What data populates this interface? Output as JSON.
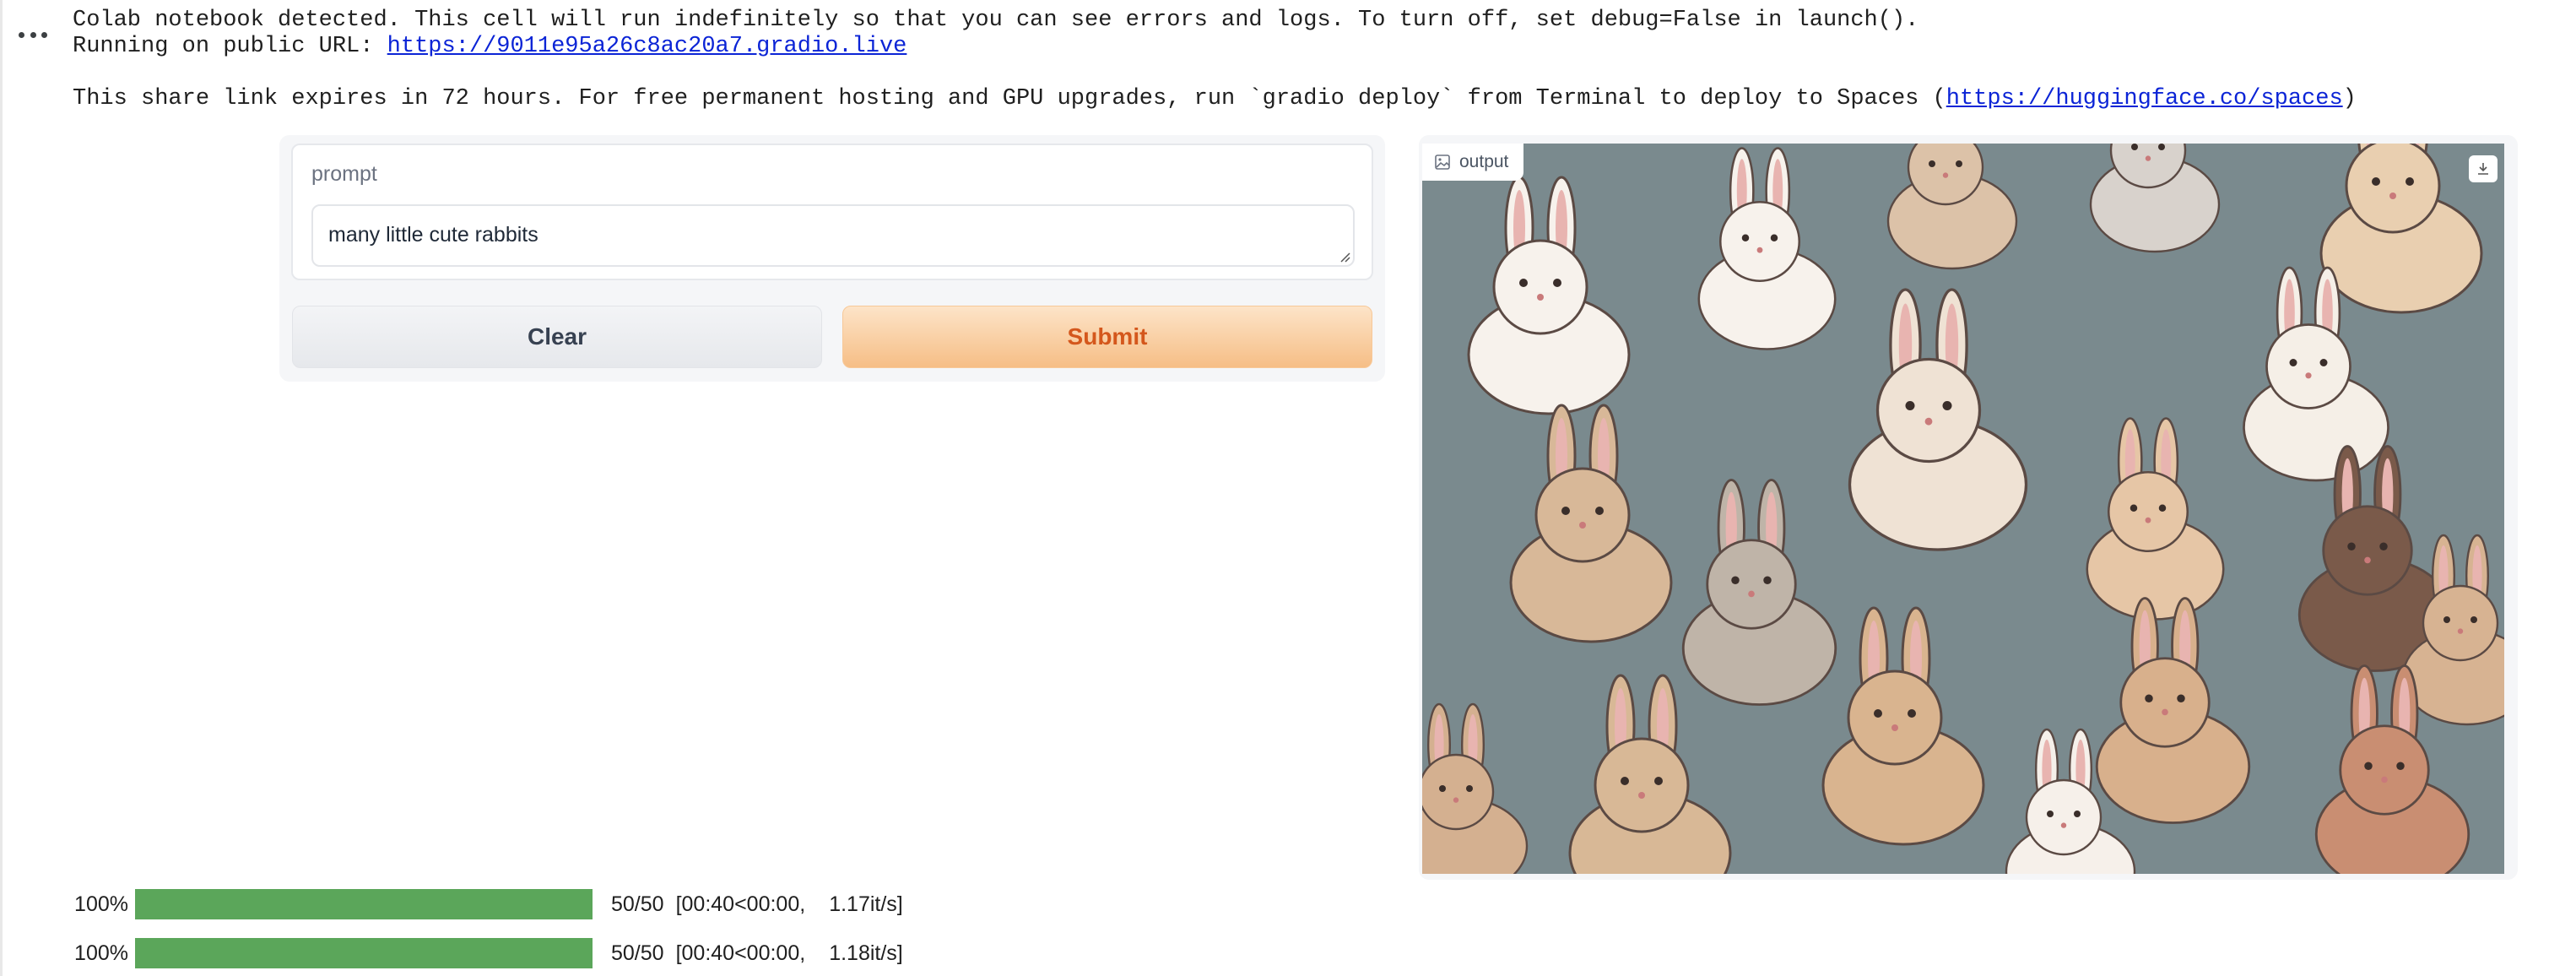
{
  "cell": {
    "more_icon": "more-horizontal-icon",
    "log_line_1": "Colab notebook detected. This cell will run indefinitely so that you can see errors and logs. To turn off, set debug=False in launch().",
    "log_line_2_prefix": "Running on public URL: ",
    "public_url": "https://9011e95a26c8ac20a7.gradio.live",
    "log_line_3_prefix": "This share link expires in 72 hours. For free permanent hosting and GPU upgrades, run `gradio deploy` from Terminal to deploy to Spaces (",
    "spaces_url": "https://huggingface.co/spaces",
    "log_line_3_suffix": ")"
  },
  "app": {
    "prompt_label": "prompt",
    "prompt_value": "many little cute rabbits",
    "clear_label": "Clear",
    "submit_label": "Submit",
    "output_label": "output",
    "output_icon": "image-icon",
    "download_icon": "download-icon",
    "accent_color": "#f6be86",
    "submit_text_color": "#d4571c"
  },
  "progress": [
    {
      "percent_label": "100%",
      "fraction": 1.0,
      "count": "50/50",
      "time": "[00:40<00:00,",
      "rate": "1.17it/s]"
    },
    {
      "percent_label": "100%",
      "fraction": 1.0,
      "count": "50/50",
      "time": "[00:40<00:00,",
      "rate": "1.18it/s]"
    }
  ],
  "colors": {
    "progress_bar": "#5ba65a",
    "link": "#0b24d6"
  }
}
